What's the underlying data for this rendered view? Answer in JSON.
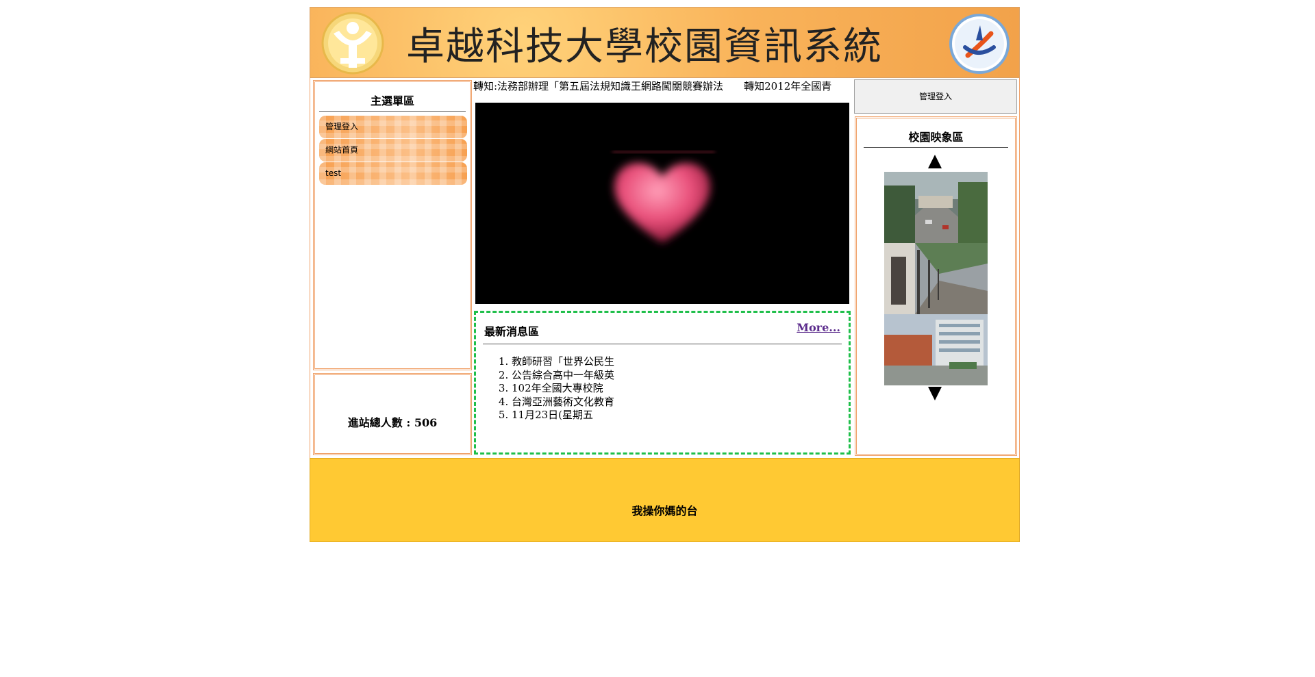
{
  "header": {
    "title": "卓越科技大學校園資訊系統",
    "left_logo_icon": "school-emblem-icon",
    "right_logo_icon": "school-logo-icon"
  },
  "sidebar": {
    "title": "主選單區",
    "items": [
      {
        "label": "管理登入"
      },
      {
        "label": "網站首頁"
      },
      {
        "label": "test"
      }
    ]
  },
  "counter": {
    "text": "進站總人數 : 506"
  },
  "marquee": {
    "items": [
      "轉知:法務部辦理「第五屆法規知識王網路闖關競賽辦法",
      "轉知2012年全國青"
    ]
  },
  "news": {
    "title": "最新消息區",
    "more_label": "More...",
    "items": [
      "教師研習「世界公民生",
      "公告綜合高中一年級英",
      "102年全國大專校院",
      "台灣亞洲藝術文化教育",
      "11月23日(星期五"
    ]
  },
  "admin_button": {
    "label": "管理登入"
  },
  "gallery": {
    "title": "校園映象區",
    "up_icon": "arrow-up-icon",
    "down_icon": "arrow-down-icon"
  },
  "footer": {
    "text": "我操你媽的台"
  },
  "colors": {
    "header_orange": "#f9b35a",
    "menu_orange": "#f7a050",
    "footer_yellow": "#ffc933",
    "news_border_green": "#1fbf4a",
    "more_link": "#5b2b8c"
  }
}
